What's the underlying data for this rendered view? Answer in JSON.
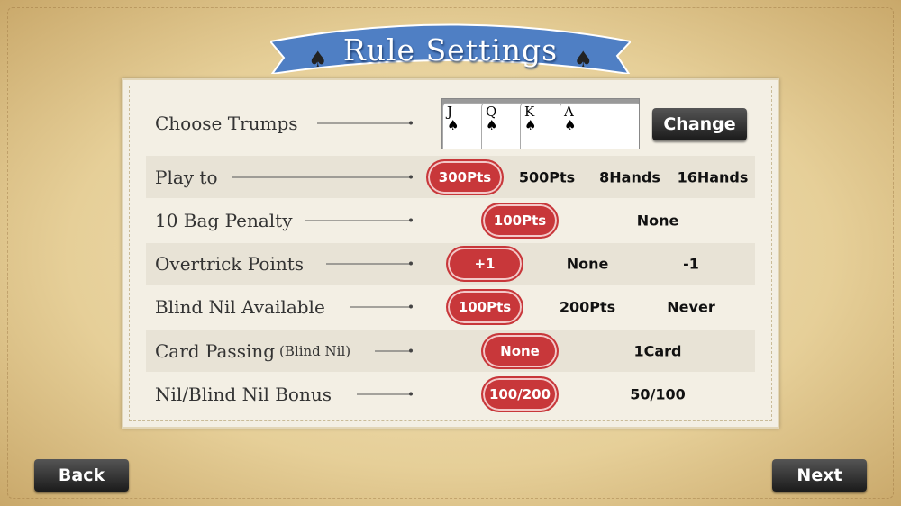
{
  "title": "Rule Settings",
  "trumps": {
    "label": "Choose Trumps",
    "cards": [
      "J",
      "Q",
      "K",
      "A"
    ],
    "suit": "♠",
    "change_label": "Change"
  },
  "rows": [
    {
      "label": "Play to",
      "options": [
        "300Pts",
        "500Pts",
        "8Hands",
        "16Hands"
      ],
      "selected": 0
    },
    {
      "label": "10 Bag Penalty",
      "options": [
        "100Pts",
        "None"
      ],
      "selected": 0
    },
    {
      "label": "Overtrick Points",
      "options": [
        "+1",
        "None",
        "-1"
      ],
      "selected": 0
    },
    {
      "label": "Blind Nil Available",
      "options": [
        "100Pts",
        "200Pts",
        "Never"
      ],
      "selected": 0
    },
    {
      "label": "Card Passing",
      "sublabel": "(Blind Nil)",
      "options": [
        "None",
        "1Card"
      ],
      "selected": 0
    },
    {
      "label": "Nil/Blind Nil Bonus",
      "options": [
        "100/200",
        "50/100"
      ],
      "selected": 0
    }
  ],
  "back_label": "Back",
  "next_label": "Next",
  "colors": {
    "banner": "#4f7fc4",
    "selected": "#c8373a",
    "button": "#222222"
  }
}
